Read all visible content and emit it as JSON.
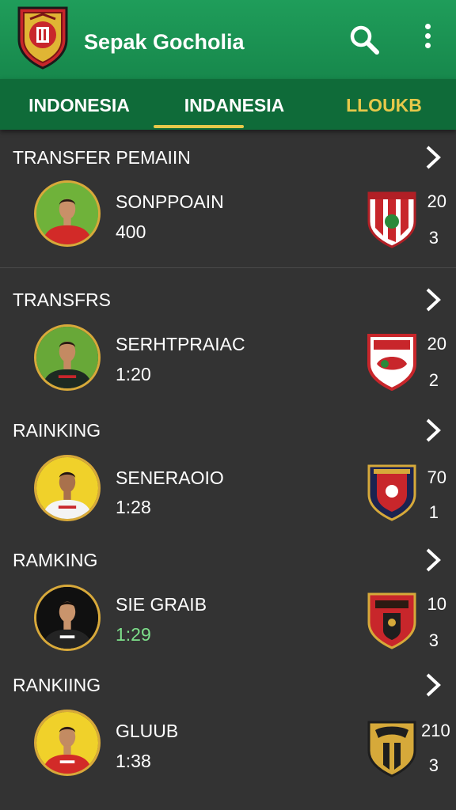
{
  "app": {
    "title": "Sepak Gocholia"
  },
  "tabs": [
    {
      "label": "INDONESIA"
    },
    {
      "label": "INDANESIA"
    },
    {
      "label": "LLOUKB"
    }
  ],
  "sections": [
    {
      "title": "TRANSFER PEMAIIN",
      "player": "SONPPOAIN",
      "value": "400",
      "num_top": "20",
      "num_bottom": "3"
    },
    {
      "title": "TRANSFRS",
      "player": "SERHTPRAIAC",
      "value": "1:20",
      "num_top": "20",
      "num_bottom": "2"
    },
    {
      "title": "RAINKING",
      "player": "SENERAOIO",
      "value": "1:28",
      "num_top": "70",
      "num_bottom": "1"
    },
    {
      "title": "RAMKING",
      "player": "SIE GRAIB",
      "value": "1:29",
      "num_top": "10",
      "num_bottom": "3"
    },
    {
      "title": "RANKIING",
      "player": "GLUUB",
      "value": "1:38",
      "num_top": "210",
      "num_bottom": "3"
    }
  ],
  "colors": {
    "appbar": "#1f9d5a",
    "tabbar": "#0f6b39",
    "accent": "#e6c84a",
    "background": "#333333",
    "highlight_value": "#7ee08b"
  },
  "icons": [
    "club-crest-icon",
    "search-icon",
    "more-vert-icon",
    "chevron-right-icon"
  ]
}
